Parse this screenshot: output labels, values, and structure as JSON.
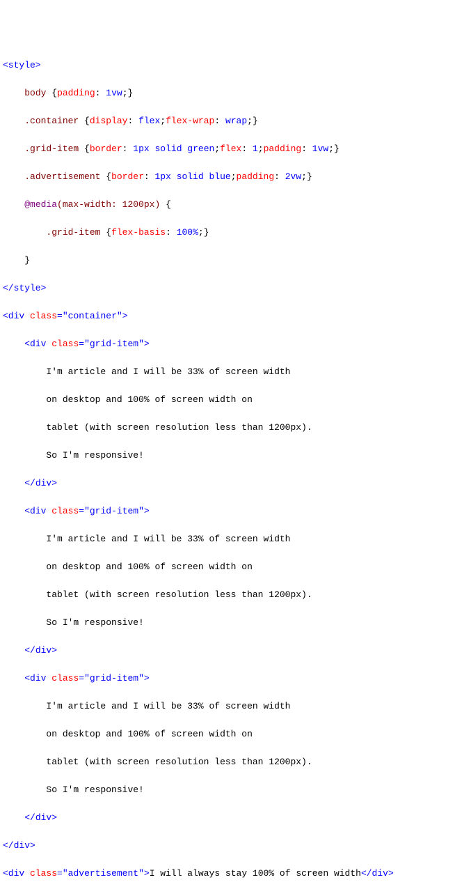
{
  "css": {
    "open_style": "<style>",
    "close_style": "</style>",
    "body_sel": "body",
    "body_rule": "padding: 1vw;",
    "container_sel": ".container",
    "container_rule": "display: flex;flex-wrap: wrap;",
    "grid_sel": ".grid-item",
    "grid_rule": "border: 1px solid green;flex: 1;padding: 1vw;",
    "ad_sel": ".advertisement",
    "ad_rule": "border: 1px solid blue;padding: 2vw;",
    "media_kw": "@media",
    "media_cond": "(max-width: 1200px)",
    "media_inner_sel": ".grid-item",
    "media_inner_rule": "flex-basis: 100%;"
  },
  "html": {
    "div_open": "<div",
    "div_close": "</div>",
    "class_attr": "class",
    "class_container": "\"container\"",
    "class_grid": "\"grid-item\"",
    "class_ad": "\"advertisement\"",
    "gt": ">",
    "article": {
      "l1": "I'm article and I will be 33% of screen width",
      "l2": "on desktop and 100% of screen width on",
      "l3": "tablet (with screen resolution less than 1200px).",
      "l4": "So I'm responsive!"
    },
    "ad_text": "I will always stay 100% of screen width"
  }
}
